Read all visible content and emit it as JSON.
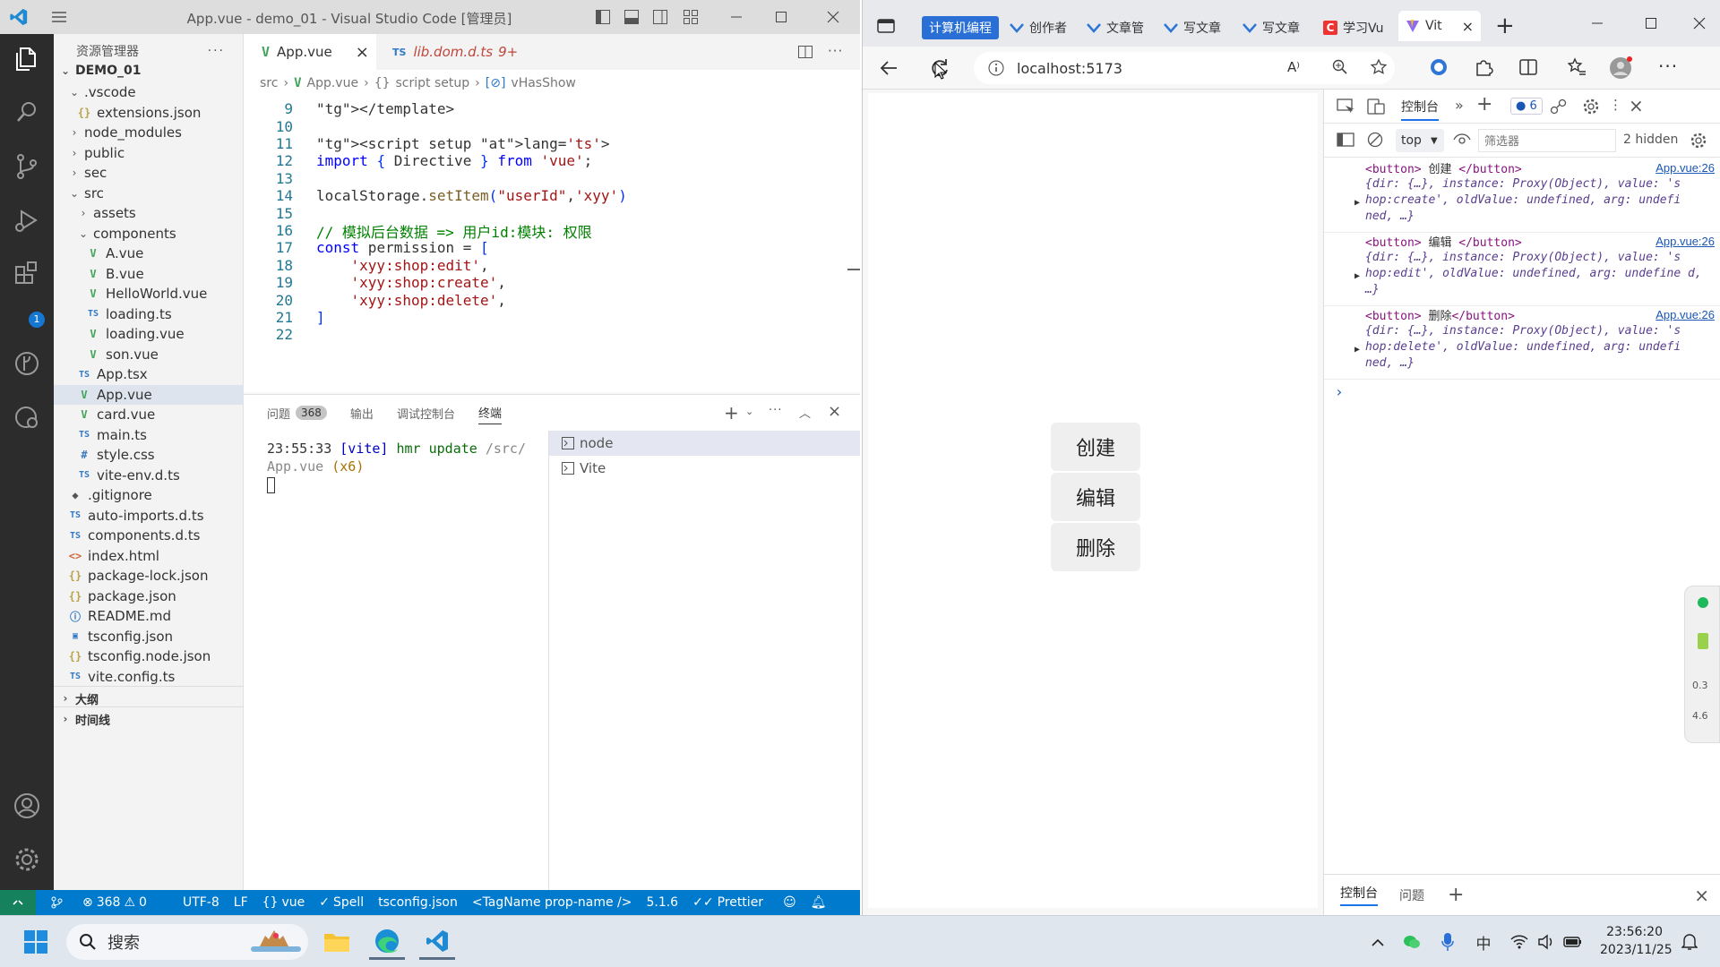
{
  "vscode": {
    "title": "App.vue - demo_01 - Visual Studio Code [管理员]",
    "sidebar": {
      "header": "资源管理器",
      "more": "···",
      "root": "DEMO_01",
      "items": [
        {
          "label": ".vscode",
          "kind": "folder-open",
          "depth": 1
        },
        {
          "label": "extensions.json",
          "kind": "json",
          "depth": 2
        },
        {
          "label": "node_modules",
          "kind": "folder",
          "depth": 1
        },
        {
          "label": "public",
          "kind": "folder",
          "depth": 1
        },
        {
          "label": "sec",
          "kind": "folder",
          "depth": 1
        },
        {
          "label": "src",
          "kind": "folder-open",
          "depth": 1
        },
        {
          "label": "assets",
          "kind": "folder",
          "depth": 2
        },
        {
          "label": "components",
          "kind": "folder-open",
          "depth": 2
        },
        {
          "label": "A.vue",
          "kind": "vue",
          "depth": 3
        },
        {
          "label": "B.vue",
          "kind": "vue",
          "depth": 3
        },
        {
          "label": "HelloWorld.vue",
          "kind": "vue",
          "depth": 3
        },
        {
          "label": "loading.ts",
          "kind": "ts",
          "depth": 3
        },
        {
          "label": "loading.vue",
          "kind": "vue",
          "depth": 3
        },
        {
          "label": "son.vue",
          "kind": "vue",
          "depth": 3
        },
        {
          "label": "App.tsx",
          "kind": "ts",
          "depth": 2
        },
        {
          "label": "App.vue",
          "kind": "vue",
          "depth": 2,
          "selected": true
        },
        {
          "label": "card.vue",
          "kind": "vue",
          "depth": 2
        },
        {
          "label": "main.ts",
          "kind": "ts",
          "depth": 2
        },
        {
          "label": "style.css",
          "kind": "css",
          "depth": 2
        },
        {
          "label": "vite-env.d.ts",
          "kind": "ts",
          "depth": 2
        },
        {
          "label": ".gitignore",
          "kind": "git",
          "depth": 1
        },
        {
          "label": "auto-imports.d.ts",
          "kind": "ts",
          "depth": 1
        },
        {
          "label": "components.d.ts",
          "kind": "ts",
          "depth": 1
        },
        {
          "label": "index.html",
          "kind": "html",
          "depth": 1
        },
        {
          "label": "package-lock.json",
          "kind": "json",
          "depth": 1
        },
        {
          "label": "package.json",
          "kind": "json",
          "depth": 1
        },
        {
          "label": "README.md",
          "kind": "info",
          "depth": 1
        },
        {
          "label": "tsconfig.json",
          "kind": "tsconf",
          "depth": 1
        },
        {
          "label": "tsconfig.node.json",
          "kind": "json",
          "depth": 1
        },
        {
          "label": "vite.config.ts",
          "kind": "ts",
          "depth": 1
        }
      ],
      "outline": "大纲",
      "timeline": "时间线"
    },
    "tabs": [
      {
        "label": "App.vue",
        "close": "×"
      },
      {
        "label": "lib.dom.d.ts",
        "badge": "9+"
      }
    ],
    "breadcrumb": [
      "src",
      "App.vue",
      "script setup",
      "vHasShow"
    ],
    "code": [
      {
        "n": "9",
        "t": "</template>"
      },
      {
        "n": "10",
        "t": ""
      },
      {
        "n": "11",
        "t": "<script setup lang='ts'>"
      },
      {
        "n": "12",
        "t": "import { Directive } from 'vue';"
      },
      {
        "n": "13",
        "t": ""
      },
      {
        "n": "14",
        "t": "localStorage.setItem(\"userId\",'xyy')"
      },
      {
        "n": "15",
        "t": ""
      },
      {
        "n": "16",
        "t": "// 模拟后台数据 => 用户id:模块: 权限"
      },
      {
        "n": "17",
        "t": "const permission = ["
      },
      {
        "n": "18",
        "t": "    'xyy:shop:edit',"
      },
      {
        "n": "19",
        "t": "    'xyy:shop:create',"
      },
      {
        "n": "20",
        "t": "    'xyy:shop:delete',"
      },
      {
        "n": "21",
        "t": "]"
      },
      {
        "n": "22",
        "t": ""
      }
    ],
    "panel": {
      "tabs": [
        "问题",
        "输出",
        "调试控制台",
        "终端"
      ],
      "problem_count": "368",
      "terminal_line1": "23:55:33 [vite] hmr update /src/",
      "terminal_line2": "App.vue (x6)",
      "terminals": [
        "node",
        "Vite"
      ]
    },
    "status": {
      "errors": "368",
      "warnings": "0",
      "encoding": "UTF-8",
      "eol": "LF",
      "lang": "vue",
      "spell": "Spell",
      "tsconfig": "tsconfig.json",
      "tagname": "<TagName prop-name />",
      "version": "5.1.6",
      "prettier": "Prettier"
    }
  },
  "browser": {
    "tabs": [
      "计算机编程",
      "创作者",
      "文章管",
      "写文章",
      "写文章",
      "学习Vu",
      "Vit"
    ],
    "url": "localhost:5173",
    "page_buttons": [
      "创建",
      "编辑",
      "删除"
    ],
    "devtools": {
      "tab_console": "控制台",
      "issues_count": "6",
      "context": "top",
      "filter_placeholder": "筛选器",
      "hidden": "2 hidden",
      "entries": [
        {
          "tag_open": "<button>",
          "text": " 创建 ",
          "tag_close": "</button>",
          "link": "App.vue:26",
          "obj": "{dir: {…}, instance: Proxy(Object), value: 's hop:create', oldValue: undefined, arg: undefi ned, …}"
        },
        {
          "tag_open": "<button>",
          "text": " 编辑 ",
          "tag_close": "</button>",
          "link": "App.vue:26",
          "obj": "{dir: {…}, instance: Proxy(Object), value: 's hop:edit', oldValue: undefined, arg: undefine d, …}"
        },
        {
          "tag_open": "<button>",
          "text": " 删除",
          "tag_close": "</button>",
          "link": "App.vue:26",
          "obj": "{dir: {…}, instance: Proxy(Object), value: 's hop:delete', oldValue: undefined, arg: undefi ned, …}"
        }
      ],
      "bottom_tabs": [
        "控制台",
        "问题"
      ]
    },
    "perf": [
      "0.3",
      "4.6"
    ]
  },
  "taskbar": {
    "search": "搜索",
    "ime": "中",
    "time": "23:56:20",
    "date": "2023/11/25"
  },
  "colors": {
    "accent": "#007acc",
    "vue": "#42a35a",
    "ts": "#3178c6"
  }
}
